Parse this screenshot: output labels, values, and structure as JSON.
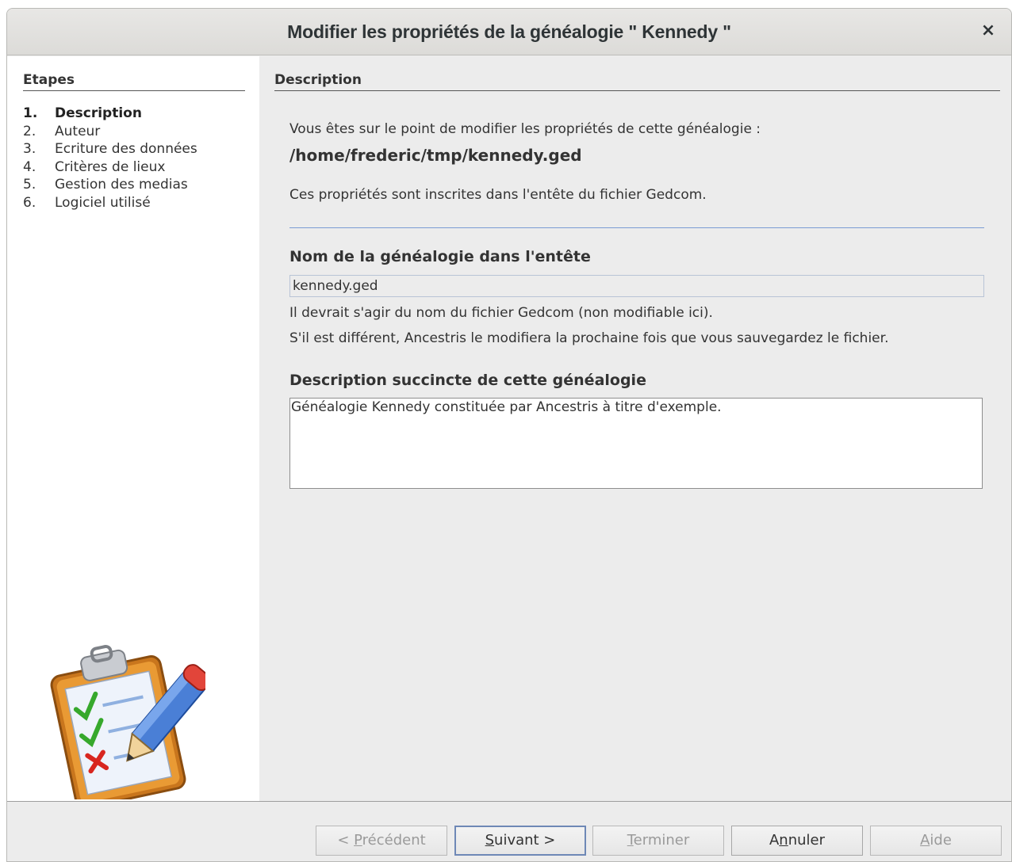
{
  "window": {
    "title": "Modifier les propriétés de la généalogie \" Kennedy \"",
    "close_glyph": "×"
  },
  "sidebar": {
    "heading": "Etapes",
    "steps": [
      {
        "num": "1.",
        "label": "Description",
        "active": true
      },
      {
        "num": "2.",
        "label": "Auteur"
      },
      {
        "num": "3.",
        "label": "Ecriture des données"
      },
      {
        "num": "4.",
        "label": "Critères de lieux"
      },
      {
        "num": "5.",
        "label": "Gestion des medias"
      },
      {
        "num": "6.",
        "label": "Logiciel utilisé"
      }
    ],
    "illustration_icon": "clipboard-checklist-pencil-icon"
  },
  "main": {
    "heading": "Description",
    "intro": "Vous êtes sur le point de modifier les propriétés de cette généalogie :",
    "file_path": "/home/frederic/tmp/kennedy.ged",
    "note": "Ces propriétés sont inscrites dans l'entête du fichier Gedcom.",
    "name_label": "Nom de la généalogie dans l'entête",
    "name_value": "kennedy.ged",
    "name_help_1": "Il devrait s'agir du nom du fichier Gedcom (non modifiable ici).",
    "name_help_2": "S'il est différent, Ancestris le modifiera la prochaine fois que vous sauvegardez le fichier.",
    "description_label": "Description succincte de cette généalogie",
    "description_value": "Généalogie Kennedy constituée par Ancestris à titre d'exemple."
  },
  "buttons": {
    "previous": {
      "prefix": "< ",
      "mnemonic": "P",
      "rest": "récédent",
      "enabled": false
    },
    "next": {
      "prefix": "",
      "mnemonic": "S",
      "rest": "uivant >",
      "enabled": true
    },
    "finish": {
      "prefix": "",
      "mnemonic": "T",
      "rest": "erminer",
      "enabled": false
    },
    "cancel": {
      "prefix": "A",
      "mnemonic": "n",
      "rest": "nuler",
      "enabled": true
    },
    "help": {
      "prefix": "",
      "mnemonic": "A",
      "rest": "ide",
      "enabled": false
    }
  },
  "colors": {
    "separator": "#7a9cd3",
    "default_button_border": "#6e88b6"
  }
}
